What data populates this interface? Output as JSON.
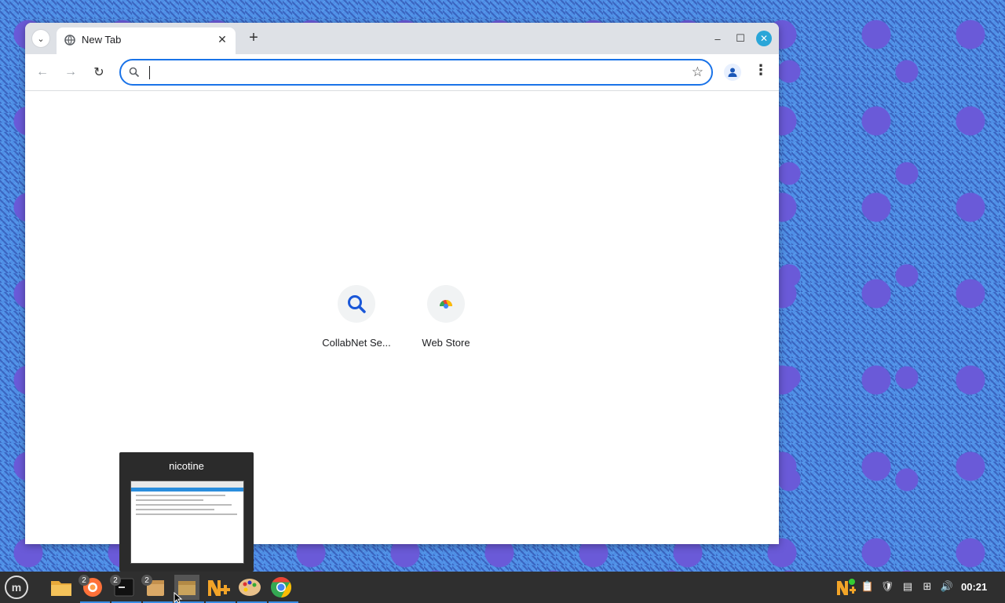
{
  "browser": {
    "tab": {
      "title": "New Tab"
    },
    "omnibox": {
      "value": "",
      "placeholder": ""
    },
    "shortcuts": [
      {
        "label": "CollabNet Se...",
        "icon": "search-icon"
      },
      {
        "label": "Web Store",
        "icon": "webstore-icon"
      }
    ]
  },
  "preview": {
    "title": "nicotine"
  },
  "taskbar": {
    "apps": [
      {
        "name": "files",
        "badge": ""
      },
      {
        "name": "firefox",
        "badge": "2"
      },
      {
        "name": "terminal",
        "badge": "2"
      },
      {
        "name": "archive",
        "badge": "2"
      },
      {
        "name": "package",
        "badge": ""
      },
      {
        "name": "nicotine",
        "badge": ""
      },
      {
        "name": "paint",
        "badge": ""
      },
      {
        "name": "chrome",
        "badge": ""
      }
    ],
    "clock": "00:21"
  },
  "colors": {
    "accent": "#1a73e8",
    "desktop": "#4f8fe6",
    "taskbar": "#2f2f2f"
  }
}
